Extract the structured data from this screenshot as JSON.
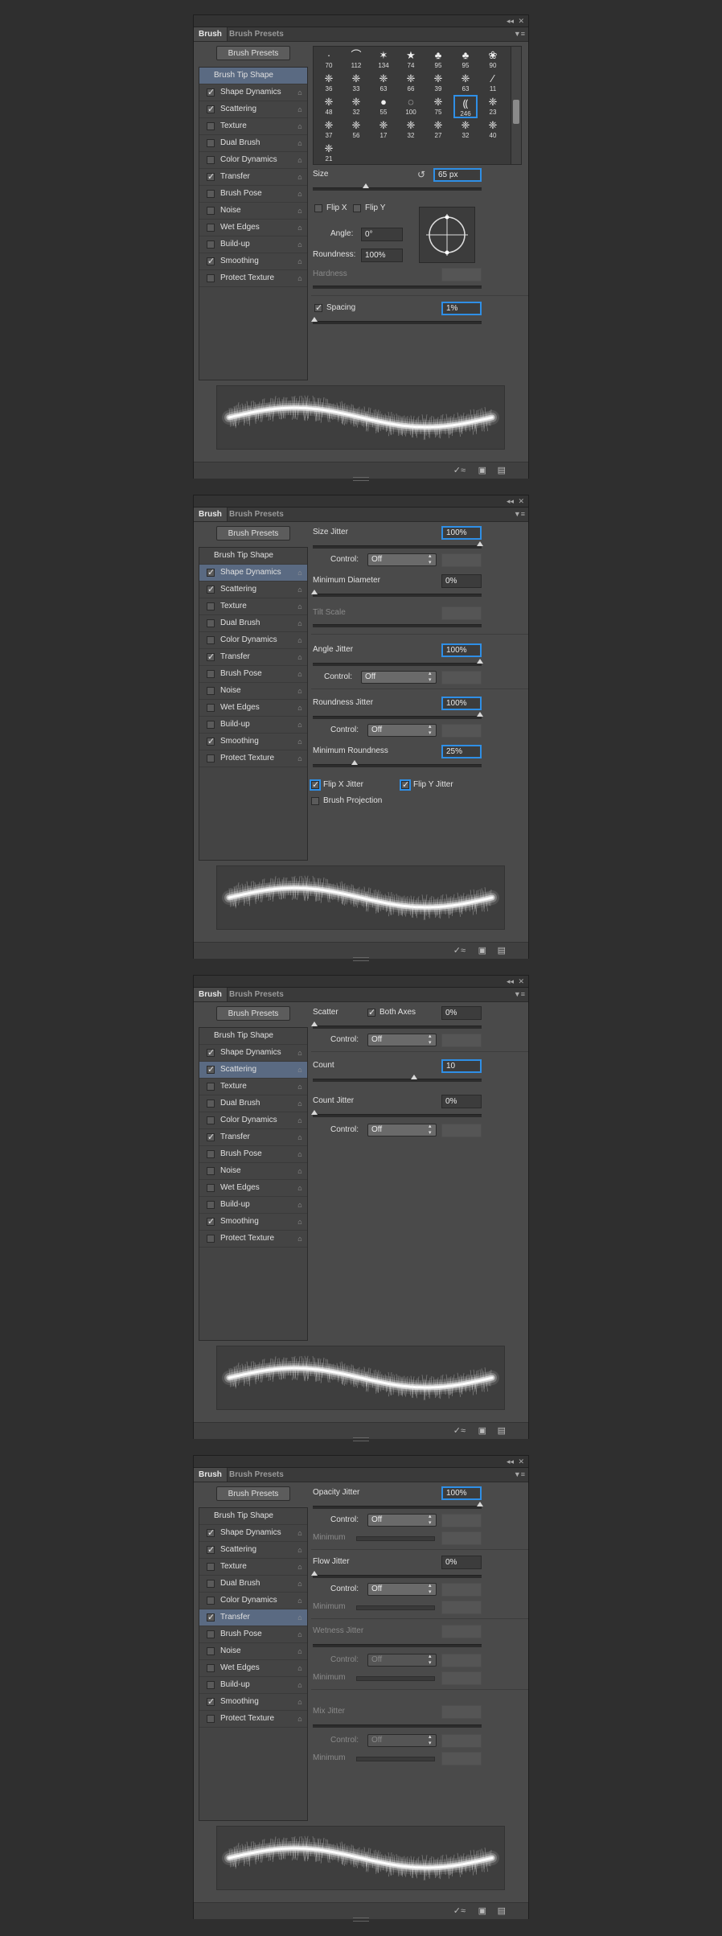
{
  "titlebar": {
    "collapse_icon": "double-chevron-icon",
    "close_icon": "close-icon"
  },
  "tabs": {
    "brush": "Brush",
    "brush_presets": "Brush Presets"
  },
  "preset_button": "Brush Presets",
  "options": [
    {
      "label": "Brush Tip Shape",
      "checkbox": false,
      "lock": false
    },
    {
      "label": "Shape Dynamics",
      "checkbox": true,
      "lock": true
    },
    {
      "label": "Scattering",
      "checkbox": true,
      "lock": true
    },
    {
      "label": "Texture",
      "checkbox": true,
      "lock": true
    },
    {
      "label": "Dual Brush",
      "checkbox": true,
      "lock": true
    },
    {
      "label": "Color Dynamics",
      "checkbox": true,
      "lock": true
    },
    {
      "label": "Transfer",
      "checkbox": true,
      "lock": true
    },
    {
      "label": "Brush Pose",
      "checkbox": true,
      "lock": true
    },
    {
      "label": "Noise",
      "checkbox": true,
      "lock": true
    },
    {
      "label": "Wet Edges",
      "checkbox": true,
      "lock": true
    },
    {
      "label": "Build-up",
      "checkbox": true,
      "lock": true
    },
    {
      "label": "Smoothing",
      "checkbox": true,
      "lock": true
    },
    {
      "label": "Protect Texture",
      "checkbox": true,
      "lock": true
    }
  ],
  "checked_options": [
    "Shape Dynamics",
    "Scattering",
    "Transfer",
    "Smoothing"
  ],
  "panel1": {
    "selected": "Brush Tip Shape",
    "thumbnails": [
      "70",
      "112",
      "134",
      "74",
      "95",
      "95",
      "90",
      "36",
      "33",
      "63",
      "66",
      "39",
      "63",
      "11",
      "48",
      "32",
      "55",
      "100",
      "75",
      "246",
      "23",
      "37",
      "56",
      "17",
      "32",
      "27",
      "32",
      "40",
      "21"
    ],
    "selected_thumb": "246",
    "size_label": "Size",
    "size_value": "65 px",
    "flip_x": "Flip X",
    "flip_y": "Flip Y",
    "angle_label": "Angle:",
    "angle_value": "0°",
    "roundness_label": "Roundness:",
    "roundness_value": "100%",
    "hardness_label": "Hardness",
    "spacing_label": "Spacing",
    "spacing_value": "1%"
  },
  "panel2": {
    "selected": "Shape Dynamics",
    "size_jitter": "Size Jitter",
    "size_jitter_value": "100%",
    "control": "Control:",
    "off": "Off",
    "min_diameter": "Minimum Diameter",
    "min_diameter_value": "0%",
    "tilt_scale": "Tilt Scale",
    "angle_jitter": "Angle Jitter",
    "angle_jitter_value": "100%",
    "roundness_jitter": "Roundness Jitter",
    "roundness_jitter_value": "100%",
    "min_roundness": "Minimum Roundness",
    "min_roundness_value": "25%",
    "flip_x_jitter": "Flip X Jitter",
    "flip_y_jitter": "Flip Y Jitter",
    "brush_projection": "Brush Projection"
  },
  "panel3": {
    "selected": "Scattering",
    "scatter": "Scatter",
    "both_axes": "Both Axes",
    "scatter_value": "0%",
    "control": "Control:",
    "off": "Off",
    "count": "Count",
    "count_value": "10",
    "count_jitter": "Count Jitter",
    "count_jitter_value": "0%"
  },
  "panel4": {
    "selected": "Transfer",
    "opacity_jitter": "Opacity Jitter",
    "opacity_jitter_value": "100%",
    "control": "Control:",
    "off": "Off",
    "minimum": "Minimum",
    "flow_jitter": "Flow Jitter",
    "flow_jitter_value": "0%",
    "wetness_jitter": "Wetness Jitter",
    "mix_jitter": "Mix Jitter"
  },
  "colors": {
    "focus": "#2f8fe6",
    "selected_row": "#5a6a82"
  }
}
